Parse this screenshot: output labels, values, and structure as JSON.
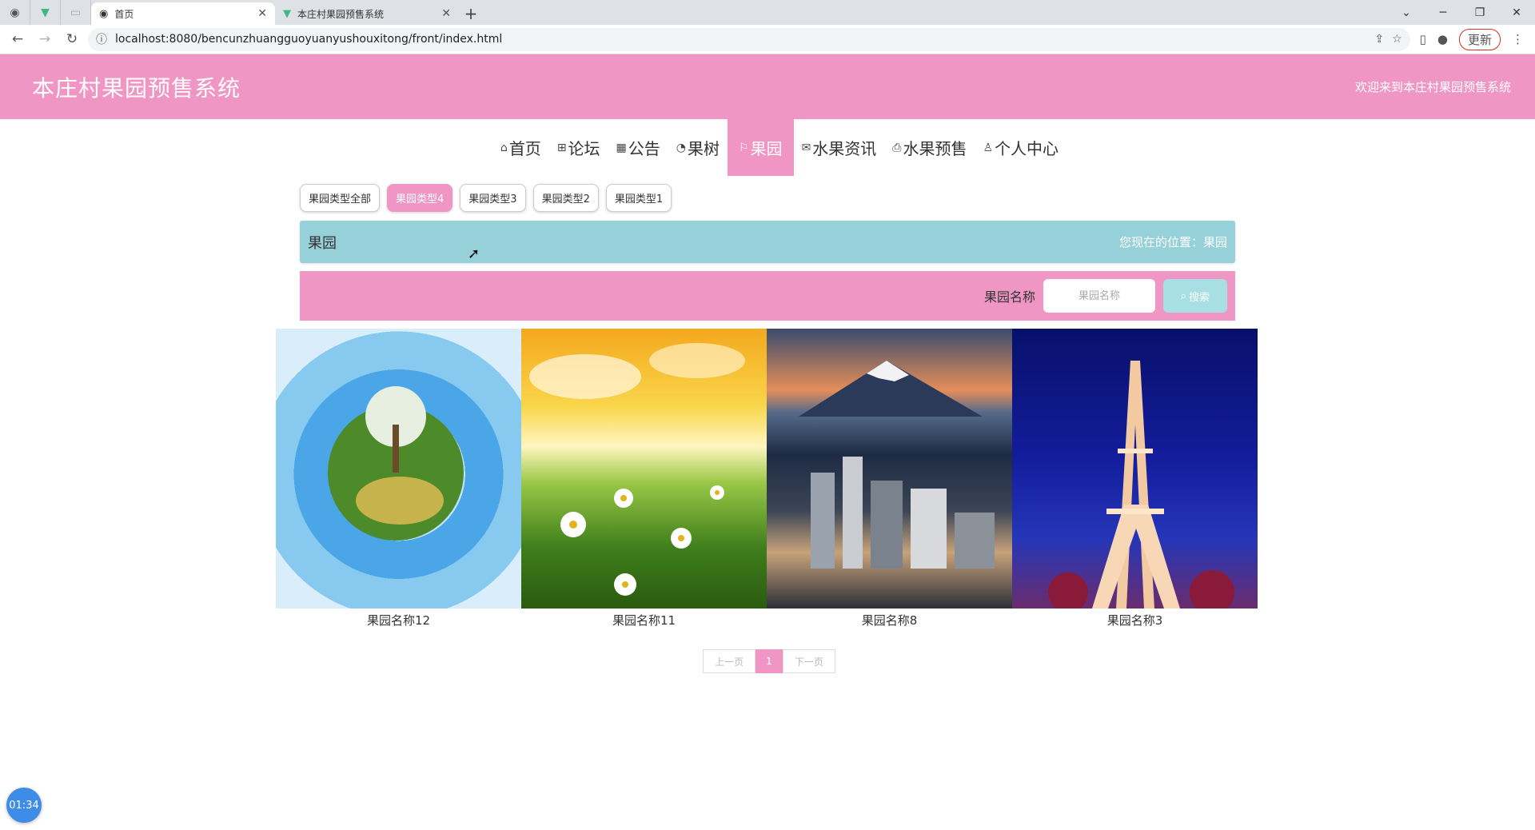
{
  "browser": {
    "tabs": [
      {
        "title": "首页",
        "active": true
      },
      {
        "title": "本庄村果园预售系统",
        "active": false
      }
    ],
    "url": "localhost:8080/bencunzhuangguoyuanyushouxitong/front/index.html",
    "update_label": "更新"
  },
  "site": {
    "title": "本庄村果园预售系统",
    "welcome": "欢迎来到本庄村果园预售系统"
  },
  "nav": {
    "items": [
      {
        "label": "首页",
        "icon": "home-icon"
      },
      {
        "label": "论坛",
        "icon": "forum-icon"
      },
      {
        "label": "公告",
        "icon": "notice-icon"
      },
      {
        "label": "果树",
        "icon": "tree-icon"
      },
      {
        "label": "果园",
        "icon": "flag-icon",
        "active": true
      },
      {
        "label": "水果资讯",
        "icon": "mail-icon"
      },
      {
        "label": "水果预售",
        "icon": "print-icon"
      },
      {
        "label": "个人中心",
        "icon": "user-icon"
      }
    ]
  },
  "categories": [
    {
      "label": "果园类型全部"
    },
    {
      "label": "果园类型4",
      "active": true
    },
    {
      "label": "果园类型3"
    },
    {
      "label": "果园类型2"
    },
    {
      "label": "果园类型1"
    }
  ],
  "breadcrumb": {
    "title": "果园",
    "position": "您现在的位置：果园"
  },
  "search": {
    "label": "果园名称",
    "placeholder": "果园名称",
    "button": "搜索"
  },
  "items": [
    {
      "name": "果园名称12"
    },
    {
      "name": "果园名称11"
    },
    {
      "name": "果园名称8"
    },
    {
      "name": "果园名称3"
    }
  ],
  "pager": {
    "prev": "上一页",
    "current": "1",
    "next": "下一页"
  },
  "timer": "01:34",
  "colors": {
    "accent_pink": "#ef96c4",
    "teal": "#96d0d8"
  }
}
